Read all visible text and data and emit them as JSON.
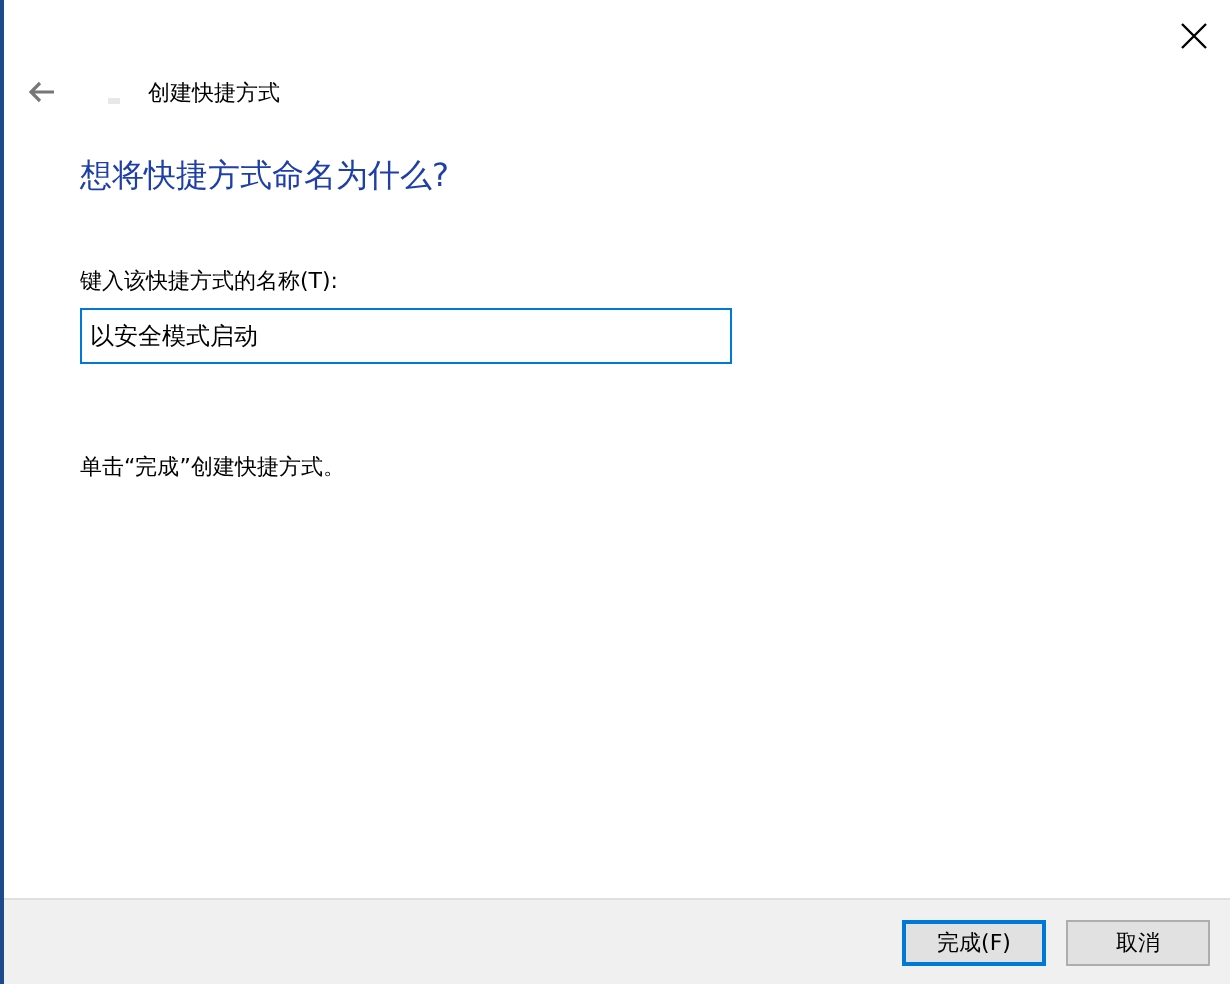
{
  "window": {
    "title": "创建快捷方式"
  },
  "heading": "想将快捷方式命名为什么?",
  "name_field": {
    "label": "键入该快捷方式的名称(T):",
    "value": "以安全模式启动"
  },
  "hint": "单击“完成”创建快捷方式。",
  "buttons": [
    {
      "label": "完成(F)",
      "default": true
    },
    {
      "label": "取消",
      "default": false
    }
  ]
}
